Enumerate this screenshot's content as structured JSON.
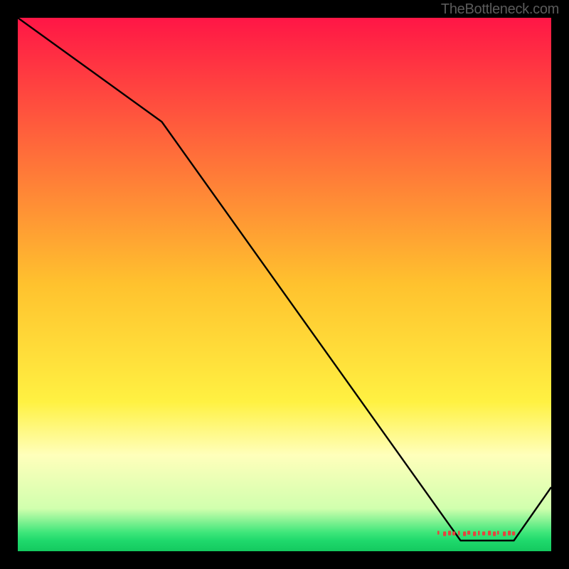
{
  "attribution": "TheBottleneck.com",
  "chart_data": {
    "type": "line",
    "title": "",
    "xlabel": "",
    "ylabel": "",
    "xlim": [
      0,
      100
    ],
    "ylim": [
      0,
      100
    ],
    "grid": false,
    "background_gradient": {
      "description": "vertical gradient red→yellow→pale-yellow→green",
      "stops": [
        {
          "offset": 0.0,
          "color": "#ff1646"
        },
        {
          "offset": 0.5,
          "color": "#ffc22e"
        },
        {
          "offset": 0.72,
          "color": "#fff142"
        },
        {
          "offset": 0.82,
          "color": "#ffffbb"
        },
        {
          "offset": 0.92,
          "color": "#d1ffae"
        },
        {
          "offset": 0.965,
          "color": "#3ee67a"
        },
        {
          "offset": 0.98,
          "color": "#1fd96c"
        },
        {
          "offset": 1.0,
          "color": "#14c95f"
        }
      ]
    },
    "series": [
      {
        "name": "curve",
        "color": "#000000",
        "x": [
          0,
          27,
          83,
          93,
          100
        ],
        "y": [
          100,
          80.5,
          2,
          2,
          12
        ]
      }
    ],
    "annotations": [
      {
        "name": "optimal-label",
        "text": "",
        "x": 86,
        "y": 3.3,
        "color": "#e2463f",
        "style": "bold-red-small"
      }
    ]
  }
}
